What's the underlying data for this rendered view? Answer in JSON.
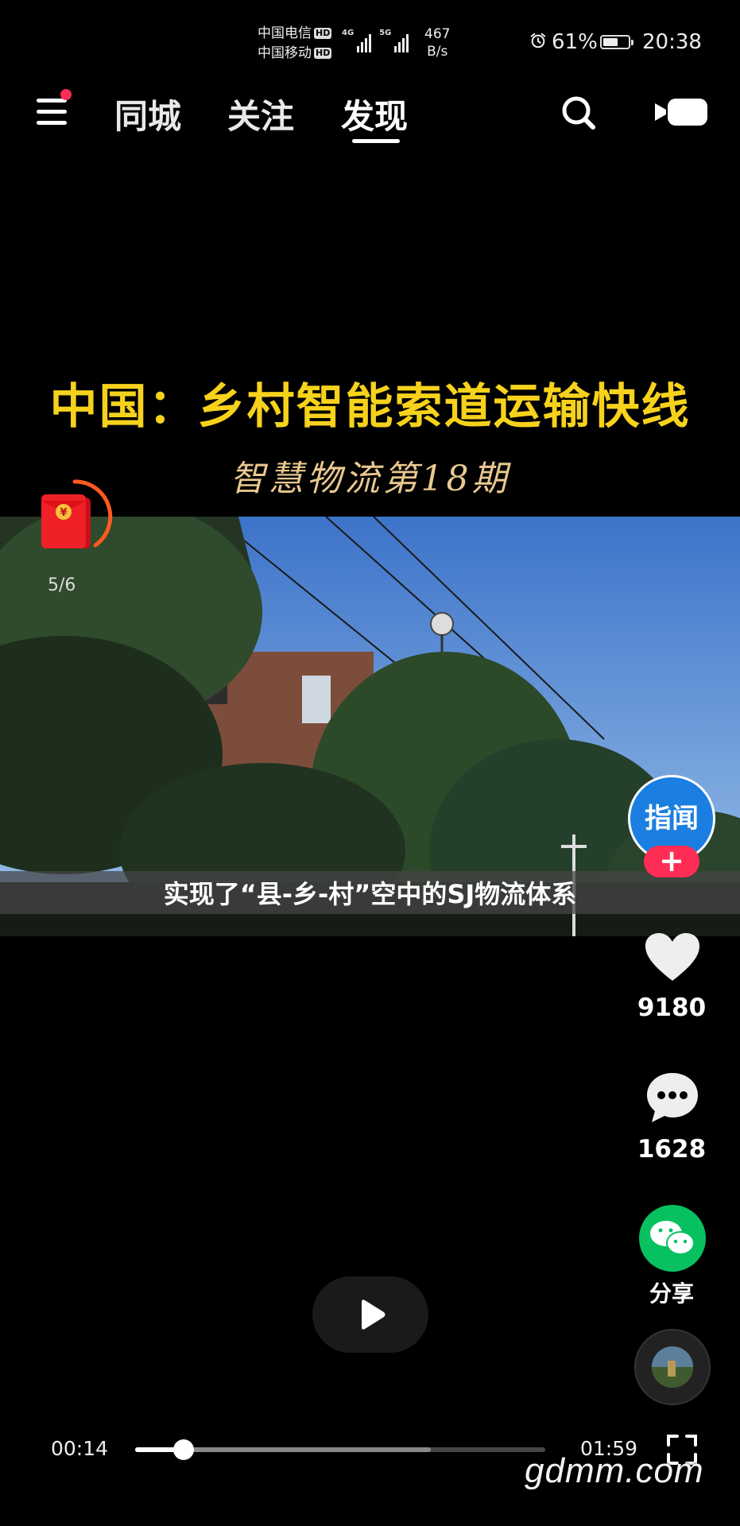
{
  "status_bar": {
    "carrier_1": "中国电信",
    "carrier_2": "中国移动",
    "hd": "HD",
    "net_1": "4G",
    "net_2": "5G",
    "speed_value": "467",
    "speed_unit": "B/s",
    "battery_percent": "61%",
    "battery_level": 0.61,
    "time": "20:38"
  },
  "nav": {
    "tabs": [
      {
        "label": "同城"
      },
      {
        "label": "关注"
      },
      {
        "label": "发现"
      }
    ],
    "active_tab": "发现",
    "menu_badge_color": "#ff2d55"
  },
  "video": {
    "title": "中国：乡村智能索道运输快线",
    "subtitle": "智慧物流第18期",
    "caption": "实现了“县-乡-村”空中的SJ物流体系"
  },
  "red_packet": {
    "progress": "5/6"
  },
  "sidebar": {
    "avatar_text": "指闻",
    "follow_symbol": "+",
    "likes": "9180",
    "comments": "1628",
    "share_label": "分享"
  },
  "player": {
    "current_time": "00:14",
    "total_time": "01:59",
    "progress_fraction": 0.118,
    "buffered_fraction": 0.72
  },
  "watermark": "gdmm.com",
  "icons": {
    "menu": "menu-icon",
    "search": "search-icon",
    "live": "camera-icon",
    "like": "heart-icon",
    "comment": "comment-icon",
    "share": "wechat-icon",
    "play": "play-icon",
    "fullscreen": "fullscreen-icon",
    "alarm": "alarm-icon"
  },
  "colors": {
    "accent": "#ff2d55",
    "wechat_green": "#07c160",
    "avatar_blue": "#1a7fe0",
    "title_yellow": "#f6d21c"
  }
}
